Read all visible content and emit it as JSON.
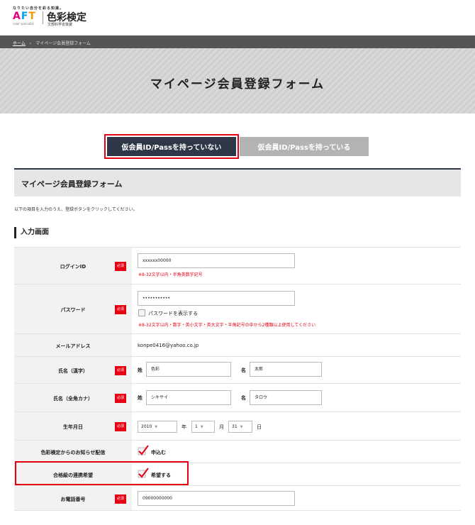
{
  "header": {
    "tagline": "なりたい自分を彩る知識。",
    "logo_aft": [
      "A",
      "F",
      "T"
    ],
    "logo_aft_sub": "color specialist",
    "logo_name": "色彩検定",
    "ministry": "文部科学省後援"
  },
  "breadcrumb": {
    "home": "ホーム",
    "separator": "›",
    "current": "マイページ会員登録フォーム"
  },
  "hero": {
    "title": "マイページ会員登録フォーム"
  },
  "toggle": {
    "no_pass": "仮会員ID/Passを持っていない",
    "has_pass": "仮会員ID/Passを持っている"
  },
  "form": {
    "title": "マイページ会員登録フォーム",
    "intro": "以下の項目を入力のうえ、登録ボタンをクリックしてください。",
    "section": "入力画面",
    "required_badge": "必須",
    "login_id": {
      "label": "ログインID",
      "value": "xxxxxx00000",
      "hint": "※8-32文字以内・半角英数字記号"
    },
    "password": {
      "label": "パスワード",
      "value": "•••••••••••",
      "show_label": "パスワードを表示する",
      "hint": "※8-32文字以内・数字・英小文字・英大文字・半角記号の中から2種類以上使用してください"
    },
    "email": {
      "label": "メールアドレス",
      "value": "konpe0416@yahoo.co.jp"
    },
    "name_kanji": {
      "label": "氏名（漢字）",
      "sei_label": "姓",
      "sei": "色彩",
      "mei_label": "名",
      "mei": "太郎"
    },
    "name_kana": {
      "label": "氏名（全角カナ）",
      "sei_label": "姓",
      "sei": "シキサイ",
      "mei_label": "名",
      "mei": "タロウ"
    },
    "birthday": {
      "label": "生年月日",
      "year": "2010",
      "year_unit": "年",
      "month": "1",
      "month_unit": "月",
      "day": "31",
      "day_unit": "日",
      "arrow": "▼"
    },
    "newsletter": {
      "label": "色彩検定からのお知らせ配信",
      "option": "申込む"
    },
    "cooperation": {
      "label": "合格級の連携希望",
      "option": "希望する"
    },
    "phone": {
      "label": "お電話番号",
      "value": "09000000000"
    }
  },
  "colors": {
    "dark_navy": "#2d3748",
    "required_red": "#e60012",
    "check_red": "#e60012",
    "label_bg": "#f2f2f2"
  }
}
